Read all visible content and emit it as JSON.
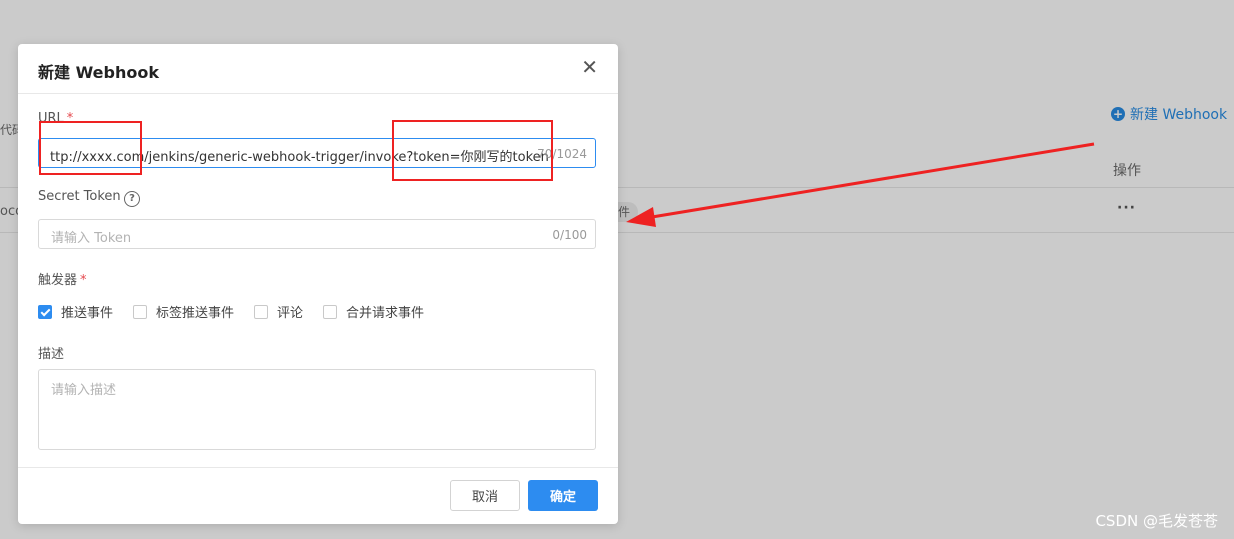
{
  "background": {
    "new_webhook_label": "新建 Webhook",
    "ops_header": "操作",
    "more_label": "···",
    "left_fragment_1": "代码",
    "left_fragment_2": "oco",
    "tag_fragment": "件"
  },
  "dialog": {
    "title": "新建 Webhook",
    "close_glyph": "✕",
    "url": {
      "label": "URL",
      "required_mark": "*",
      "value": "ttp://xxxx.com/jenkins/generic-webhook-trigger/invoke?token=你刚写的token",
      "counter": "70/1024"
    },
    "secret": {
      "label": "Secret Token",
      "help_glyph": "?",
      "placeholder": "请输入 Token",
      "counter": "0/100"
    },
    "trigger": {
      "label": "触发器",
      "required_mark": "*",
      "options": [
        {
          "label": "推送事件",
          "checked": true
        },
        {
          "label": "标签推送事件",
          "checked": false
        },
        {
          "label": "评论",
          "checked": false
        },
        {
          "label": "合并请求事件",
          "checked": false
        }
      ]
    },
    "description": {
      "label": "描述",
      "placeholder": "请输入描述"
    },
    "buttons": {
      "cancel": "取消",
      "ok": "确定"
    }
  },
  "watermark": "CSDN @毛发苍苍",
  "colors": {
    "accent": "#2d8cf0",
    "annotation": "#ee2222",
    "overlay": "#cbcbcb"
  }
}
